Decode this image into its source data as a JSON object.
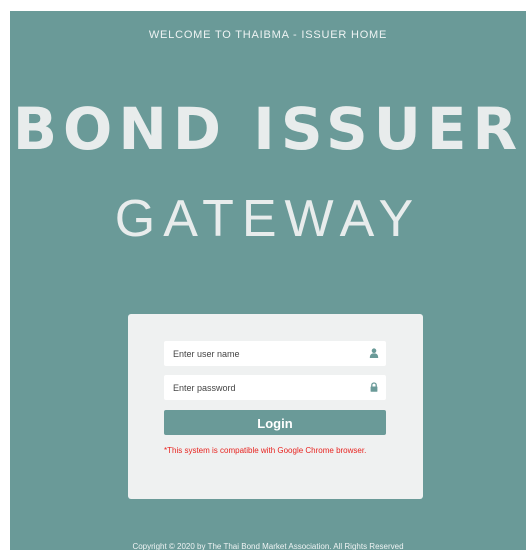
{
  "header": {
    "welcome_text": "WELCOME TO THAIBMA - ISSUER HOME"
  },
  "hero": {
    "title_line1": "BOND ISSUER",
    "title_line2": "GATEWAY"
  },
  "login": {
    "username_placeholder": "Enter user name",
    "username_icon": "user-icon",
    "password_placeholder": "Enter password",
    "password_icon": "lock-icon",
    "button_label": "Login",
    "compatibility_note": "*This system is compatible with Google Chrome browser."
  },
  "footer": {
    "copyright": "Copyright © 2020 by The Thai Bond Market Association. All Rights Reserved"
  },
  "colors": {
    "background": "#6a9a98",
    "panel": "#eff1f1",
    "button": "#6a9a98",
    "warning": "#e8231f"
  }
}
